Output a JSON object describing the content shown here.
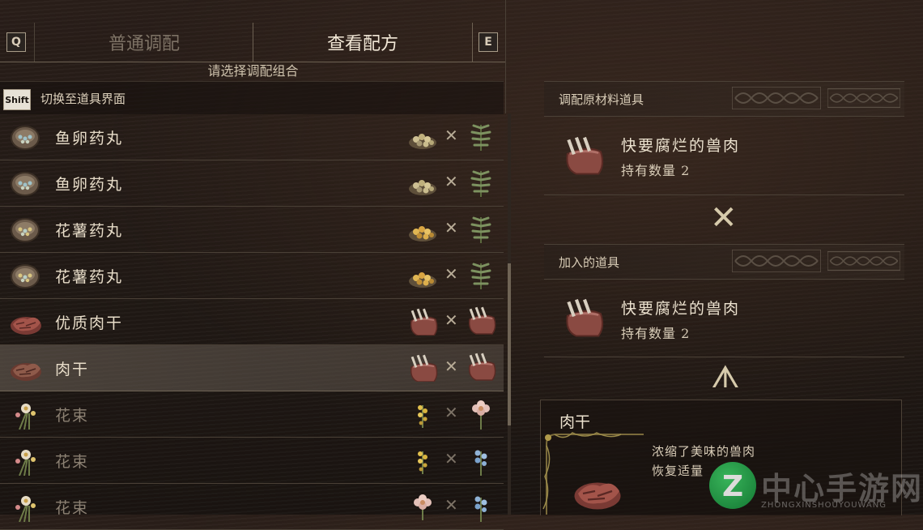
{
  "keys": {
    "left": "Q",
    "right": "E",
    "shift": "Shift"
  },
  "tabs": [
    {
      "label": "普通调配",
      "active": false
    },
    {
      "label": "查看配方",
      "active": true
    }
  ],
  "subtitle": "请选择调配组合",
  "shift_hint": "切换至道具界面",
  "recipes": [
    {
      "name": "鱼卵药丸",
      "icon": "fish-roe-pill",
      "ing1": "ingredient-seeds",
      "ing2": "herb-sprig",
      "selected": false,
      "dim": false
    },
    {
      "name": "鱼卵药丸",
      "icon": "fish-roe-pill",
      "ing1": "ingredient-seeds",
      "ing2": "herb-sprig",
      "selected": false,
      "dim": false
    },
    {
      "name": "花薯药丸",
      "icon": "flower-yam-pill",
      "ing1": "ingredient-yellow-seeds",
      "ing2": "herb-sprig",
      "selected": false,
      "dim": false
    },
    {
      "name": "花薯药丸",
      "icon": "flower-yam-pill",
      "ing1": "ingredient-yellow-seeds",
      "ing2": "herb-sprig",
      "selected": false,
      "dim": false
    },
    {
      "name": "优质肉干",
      "icon": "premium-jerky",
      "ing1": "rotten-meat",
      "ing2": "rotten-meat",
      "selected": false,
      "dim": false
    },
    {
      "name": "肉干",
      "icon": "jerky",
      "ing1": "rotten-meat",
      "ing2": "rotten-meat",
      "selected": true,
      "dim": false
    },
    {
      "name": "花束",
      "icon": "bouquet",
      "ing1": "yellow-flower",
      "ing2": "pink-flower",
      "selected": false,
      "dim": true
    },
    {
      "name": "花束",
      "icon": "bouquet",
      "ing1": "yellow-flower",
      "ing2": "blue-flower",
      "selected": false,
      "dim": true
    },
    {
      "name": "花束",
      "icon": "bouquet",
      "ing1": "pink-flower",
      "ing2": "blue-flower",
      "selected": false,
      "dim": true
    }
  ],
  "times_symbol": "✕",
  "right_panel": {
    "section1_title": "调配原材料道具",
    "material": {
      "name": "快要腐烂的兽肉",
      "count": "持有数量 2"
    },
    "section2_title": "加入的道具",
    "added": {
      "name": "快要腐烂的兽肉",
      "count": "持有数量 2"
    },
    "combine_symbol": "✕",
    "result_symbol": "ᗑ",
    "result": {
      "name": "肉干",
      "desc_line1": "浓缩了美味的兽肉",
      "desc_line2": "恢复适量"
    }
  },
  "watermark": {
    "text": "中心手游网",
    "sub": "ZHONGXINSHOUYOUWANG"
  },
  "colors": {
    "accent": "#d6caab",
    "text": "#e7dcc8",
    "dim": "#8c8173",
    "meat": "#8a4a42"
  }
}
